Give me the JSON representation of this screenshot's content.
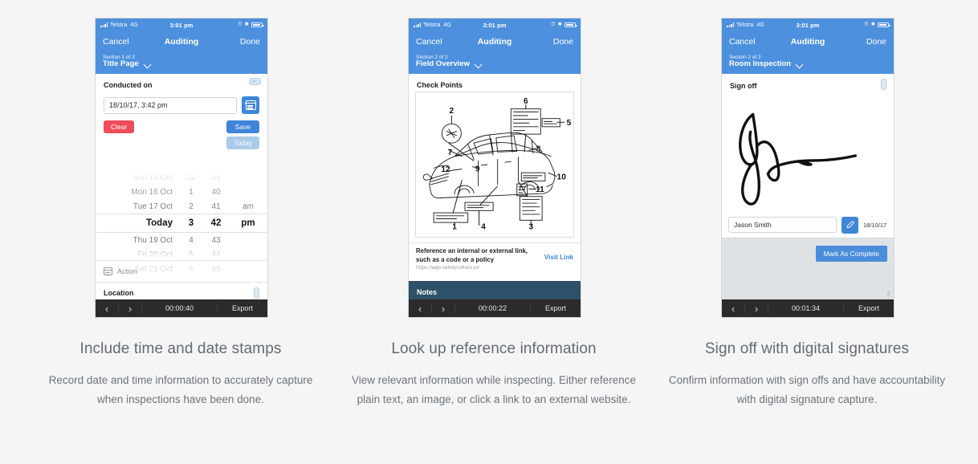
{
  "statusbar": {
    "carrier": "Telstra",
    "network": "4G",
    "time": "3:01 pm",
    "icons": [
      "alarm-icon",
      "bluetooth-icon",
      "battery-icon"
    ]
  },
  "navbar": {
    "cancel": "Cancel",
    "title": "Auditing",
    "done": "Done"
  },
  "columns": [
    {
      "section": {
        "counter": "Section 1 of 2",
        "name": "Title Page"
      },
      "screen": {
        "field_label": "Conducted on",
        "date_value": "18/10/17, 3:42 pm",
        "clear_button": "Clear",
        "save_button": "Save",
        "today_button": "Today",
        "picker": {
          "rows": [
            {
              "date": "Sun 15 Oct",
              "hour": "12",
              "minute": "39",
              "meridiem": "",
              "state": "faint"
            },
            {
              "date": "Mon 16 Oct",
              "hour": "1",
              "minute": "40",
              "meridiem": "",
              "state": "mid"
            },
            {
              "date": "Tue 17 Oct",
              "hour": "2",
              "minute": "41",
              "meridiem": "am",
              "state": "near"
            },
            {
              "date": "Today",
              "hour": "3",
              "minute": "42",
              "meridiem": "pm",
              "state": "sel"
            },
            {
              "date": "Thu 19 Oct",
              "hour": "4",
              "minute": "43",
              "meridiem": "",
              "state": "near"
            },
            {
              "date": "Fri 20 Oct",
              "hour": "5",
              "minute": "44",
              "meridiem": "",
              "state": "mid"
            },
            {
              "date": "Sat 21 Oct",
              "hour": "6",
              "minute": "45",
              "meridiem": "",
              "state": "faint"
            }
          ]
        },
        "action_row": "Action",
        "location_row": "Location"
      },
      "bottombar": {
        "timer": "00:00:40",
        "export": "Export"
      },
      "caption": {
        "title": "Include time and date stamps",
        "body": "Record date and time information to accurately capture when inspections have been done."
      }
    },
    {
      "section": {
        "counter": "Section 2 of 2",
        "name": "Field Overview"
      },
      "screen": {
        "field_label": "Check Points",
        "diagram_callouts": [
          "1",
          "2",
          "3",
          "4",
          "5",
          "6",
          "7",
          "8",
          "9",
          "10",
          "11",
          "12"
        ],
        "reference_text": "Reference an internal or external link, such as a code or a policy",
        "reference_url": "https://app.safetyculture.io/",
        "visit_link": "Visit Link",
        "notes_label": "Notes"
      },
      "bottombar": {
        "timer": "00:00:22",
        "export": "Export"
      },
      "caption": {
        "title": "Look up reference information",
        "body": "View relevant information while inspecting. Either reference plain text, an image, or click a link to an external website."
      }
    },
    {
      "section": {
        "counter": "Section 2 of 2",
        "name": "Room Inspection"
      },
      "screen": {
        "field_label": "Sign off",
        "signer_name": "Jason Smith",
        "signature_date": "18/10/17",
        "mark_complete_button": "Mark As Complete"
      },
      "bottombar": {
        "timer": "00:01:34",
        "export": "Export"
      },
      "caption": {
        "title": "Sign off with digital signatures",
        "body": "Confirm information with sign offs and have accountability with digital signature capture."
      }
    }
  ],
  "colors": {
    "header_blue": "#4d90dd",
    "accent_blue": "#3f86d8",
    "danger_red": "#ef4c5a",
    "notes_slate": "#2d5169",
    "bottombar_dark": "#2b2b2b",
    "page_bg": "#f5f5f5",
    "caption_text": "#6b747c"
  }
}
